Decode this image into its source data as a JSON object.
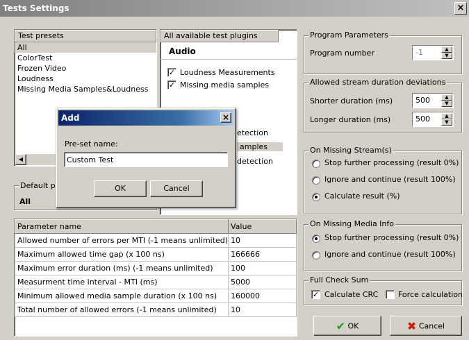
{
  "window": {
    "title": "Tests Settings",
    "close": "×"
  },
  "presets": {
    "header": "Test presets",
    "items": [
      "All",
      "ColorTest",
      "Frozen Video",
      "Loudness",
      "Missing Media Samples&Loudness"
    ],
    "selected_index": 0
  },
  "plugins": {
    "header": "All available test plugins",
    "group_audio": "Audio",
    "audio_items": [
      {
        "label": "Loudness Measurements",
        "checked": true
      },
      {
        "label": "Missing media samples",
        "checked": true
      }
    ],
    "hidden_fragments": [
      "etection",
      "amples",
      "detection"
    ]
  },
  "default_preset": {
    "label": "Default p",
    "value": "All"
  },
  "program_params": {
    "title": "Program Parameters",
    "program_number_label": "Program number",
    "program_number_value": "-1"
  },
  "durations": {
    "title": "Allowed stream duration deviations",
    "shorter_label": "Shorter duration (ms)",
    "shorter_value": "500",
    "longer_label": "Longer duration (ms)",
    "longer_value": "500"
  },
  "missing_stream": {
    "title": "On Missing Stream(s)",
    "options": [
      "Stop further processing (result 0%)",
      "Ignore and continue (result 100%)",
      "Calculate result (%)"
    ],
    "selected_index": 2
  },
  "missing_media": {
    "title": "On Missing Media Info",
    "options": [
      "Stop further processing (result 0%)",
      "Ignore and continue (result 100%)"
    ],
    "selected_index": 0
  },
  "checksum": {
    "title": "Full Check Sum",
    "calculate_crc": "Calculate CRC",
    "calculate_crc_checked": true,
    "force": "Force calculation",
    "force_checked": false
  },
  "params_table": {
    "col_name": "Parameter name",
    "col_value": "Value",
    "rows": [
      {
        "name": "Allowed number of errors per MTI (-1 means unlimited)",
        "value": "10"
      },
      {
        "name": "Maximum allowed time gap (x 100 ns)",
        "value": "166666"
      },
      {
        "name": "Maximum error duration (ms) (-1 means unlimited)",
        "value": "100"
      },
      {
        "name": "Measurment time interval - MTI (ms)",
        "value": "5000"
      },
      {
        "name": "Minimum allowed media sample duration (x 100 ns)",
        "value": "160000"
      },
      {
        "name": "Total number of allowed errors (-1 means unlimited)",
        "value": "10"
      }
    ]
  },
  "buttons": {
    "ok": "OK",
    "cancel": "Cancel"
  },
  "add_dialog": {
    "title": "Add",
    "name_label": "Pre-set name:",
    "name_value": "Custom Test",
    "ok": "OK",
    "cancel": "Cancel",
    "close": "×"
  },
  "colors": {
    "ok_check": "#1e9e1e",
    "cancel_x": "#d01c00",
    "dialog_title": "#0a246a"
  }
}
